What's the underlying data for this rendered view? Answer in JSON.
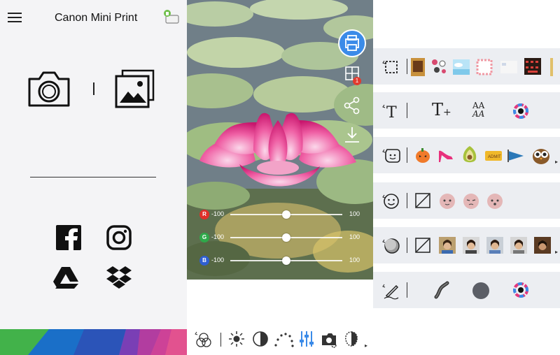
{
  "app": {
    "title": "Canon Mini Print"
  },
  "left_panel": {
    "icons": [
      "menu-icon",
      "printer-status-icon",
      "camera-icon",
      "gallery-icon",
      "facebook-icon",
      "instagram-icon",
      "google-drive-icon",
      "dropbox-icon"
    ]
  },
  "sliders": [
    {
      "channel": "R",
      "min_label": "-100",
      "max_label": "100",
      "value": 0,
      "color": "#e0302a"
    },
    {
      "channel": "G",
      "min_label": "-100",
      "max_label": "100",
      "value": 0,
      "color": "#2fa84a"
    },
    {
      "channel": "B",
      "min_label": "-100",
      "max_label": "100",
      "value": 0,
      "color": "#2f5fd0"
    }
  ],
  "photo_actions": {
    "print_badge": "1",
    "icons": [
      "print-icon",
      "tile-print-icon",
      "share-icon",
      "download-icon"
    ]
  },
  "bottom_toolbar": {
    "icons": [
      "color-filter-icon",
      "brightness-icon",
      "contrast-icon",
      "saturation-icon",
      "rgb-adjust-icon",
      "blemish-icon",
      "smooth-skin-icon"
    ]
  },
  "right_panel": {
    "rows": [
      {
        "name": "frames-row",
        "lead": "frame-icon"
      },
      {
        "name": "text-row",
        "lead": "text-tool-icon",
        "items": [
          "T+",
          "AA/AA"
        ]
      },
      {
        "name": "stickers-row",
        "lead": "sticker-icon"
      },
      {
        "name": "face-stickers-row",
        "lead": "face-sticker-icon"
      },
      {
        "name": "face-swap-row",
        "lead": "face-swap-icon"
      },
      {
        "name": "draw-row",
        "lead": "pen-icon"
      }
    ],
    "text_row": {
      "add_text": "T",
      "font_size_label": "AA"
    }
  },
  "colors": {
    "accent_blue": "#3b8be8",
    "badge_red": "#e23a2e",
    "panel_bg": "#f4f4f6",
    "row_bg": "#eceef2"
  }
}
